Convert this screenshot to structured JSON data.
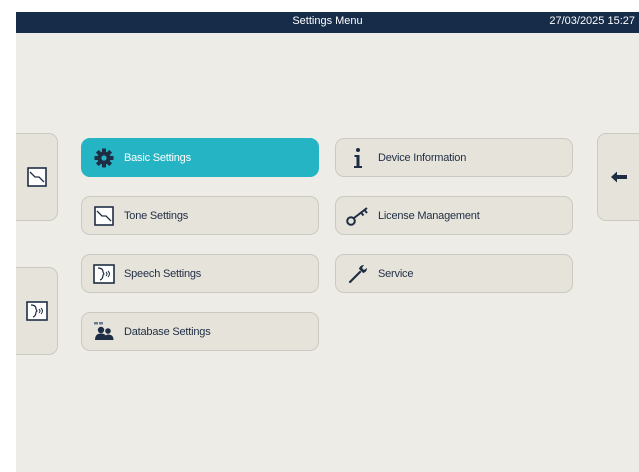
{
  "header": {
    "title": "Settings Menu",
    "datetime": "27/03/2025 15:27"
  },
  "menu": {
    "left": [
      {
        "label": "Basic Settings",
        "icon": "gear-icon",
        "active": true
      },
      {
        "label": "Tone Settings",
        "icon": "tone-curve-icon",
        "active": false
      },
      {
        "label": "Speech Settings",
        "icon": "speech-head-icon",
        "active": false
      },
      {
        "label": "Database Settings",
        "icon": "users-database-icon",
        "active": false
      }
    ],
    "right": [
      {
        "label": "Device Information",
        "icon": "info-icon"
      },
      {
        "label": "License Management",
        "icon": "key-icon"
      },
      {
        "label": "Service",
        "icon": "wrench-icon"
      }
    ]
  },
  "side_nav": {
    "left_top_icon": "tone-curve-icon",
    "left_bottom_icon": "speech-head-icon",
    "right_icon": "back-arrow-icon"
  },
  "colors": {
    "header_bg": "#162c49",
    "accent": "#24b4c4",
    "screen_bg": "#eeece6",
    "button_bg": "#e6e3da",
    "text": "#1f2d44"
  }
}
